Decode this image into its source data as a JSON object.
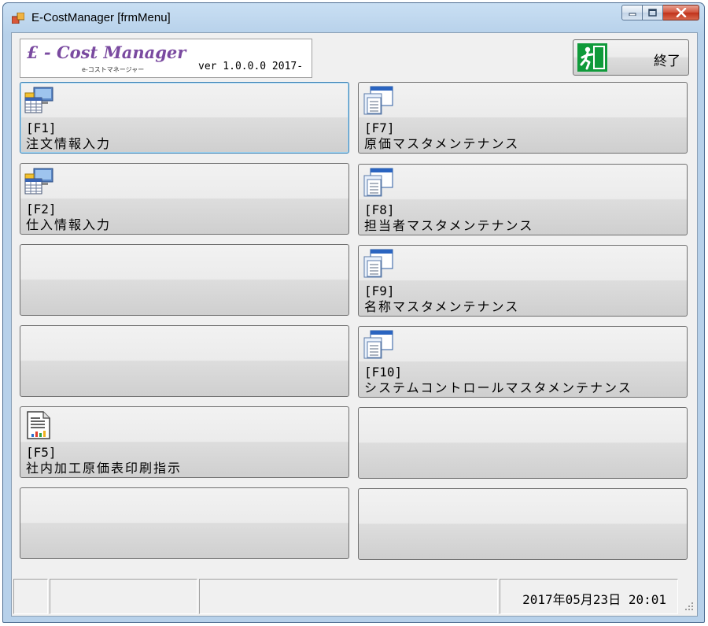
{
  "window": {
    "title": "E-CostManager [frmMenu]",
    "controls": {
      "minimize": "minimize-icon",
      "maximize": "maximize-icon",
      "close": "close-icon"
    }
  },
  "header": {
    "logo_text": "£ - Cost Manager",
    "logo_subtitle": "e-コストマネージャー",
    "version": "ver 1.0.0.0  2017-",
    "exit_label": "終了"
  },
  "menu": {
    "left": [
      {
        "key": "[F1]",
        "label": "注文情報入力",
        "icon": "computer-table-icon"
      },
      {
        "key": "[F2]",
        "label": "仕入情報入力",
        "icon": "computer-table-icon"
      },
      {
        "key": "",
        "label": "",
        "icon": ""
      },
      {
        "key": "",
        "label": "",
        "icon": ""
      },
      {
        "key": "[F5]",
        "label": "社内加工原価表印刷指示",
        "icon": "report-icon"
      },
      {
        "key": "",
        "label": "",
        "icon": ""
      }
    ],
    "right": [
      {
        "key": "[F7]",
        "label": "原価マスタメンテナンス",
        "icon": "windows-icon"
      },
      {
        "key": "[F8]",
        "label": "担当者マスタメンテナンス",
        "icon": "windows-icon"
      },
      {
        "key": "[F9]",
        "label": "名称マスタメンテナンス",
        "icon": "windows-icon"
      },
      {
        "key": "[F10]",
        "label": "システムコントロールマスタメンテナンス",
        "icon": "windows-icon"
      },
      {
        "key": "",
        "label": "",
        "icon": ""
      },
      {
        "key": "",
        "label": "",
        "icon": ""
      }
    ]
  },
  "status": {
    "datetime": "2017年05月23日 20:01"
  },
  "colors": {
    "titlebar": "#b7d1ea",
    "client_bg": "#f0f0f0",
    "focus_border": "#3c7fb1",
    "exit_icon_green": "#0f9a3a"
  }
}
